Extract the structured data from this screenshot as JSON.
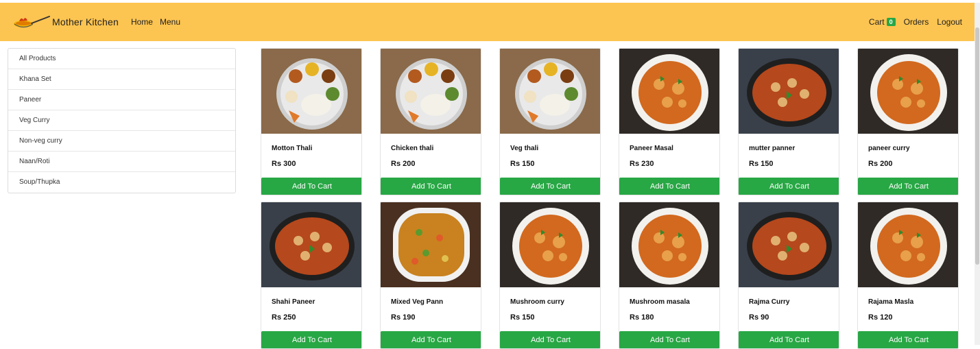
{
  "navbar": {
    "brand": "Mother Kitchen",
    "links": [
      "Home",
      "Menu"
    ],
    "cart_label": "Cart",
    "cart_count": "0",
    "orders_label": "Orders",
    "logout_label": "Logout"
  },
  "sidebar": {
    "categories": [
      "All Products",
      "Khana Set",
      "Paneer",
      "Veg Curry",
      "Non-veg curry",
      "Naan/Roti",
      "Soup/Thupka"
    ]
  },
  "products": [
    {
      "name": "Motton Thali",
      "price": "Rs 300",
      "button": "Add To Cart",
      "image": "thali-plate"
    },
    {
      "name": "Chicken thali",
      "price": "Rs 200",
      "button": "Add To Cart",
      "image": "thali-plate"
    },
    {
      "name": "Veg thali",
      "price": "Rs 150",
      "button": "Add To Cart",
      "image": "thali-plate"
    },
    {
      "name": "Paneer Masal",
      "price": "Rs 230",
      "button": "Add To Cart",
      "image": "curry-bowl"
    },
    {
      "name": "mutter panner",
      "price": "Rs 150",
      "button": "Add To Cart",
      "image": "curry-pan"
    },
    {
      "name": "paneer curry",
      "price": "Rs 200",
      "button": "Add To Cart",
      "image": "curry-bowl"
    },
    {
      "name": "Shahi Paneer",
      "price": "Rs 250",
      "button": "Add To Cart",
      "image": "curry-pan"
    },
    {
      "name": "Mixed Veg Pann",
      "price": "Rs 190",
      "button": "Add To Cart",
      "image": "curry-dish"
    },
    {
      "name": "Mushroom curry",
      "price": "Rs 150",
      "button": "Add To Cart",
      "image": "curry-bowl"
    },
    {
      "name": "Mushroom masala",
      "price": "Rs 180",
      "button": "Add To Cart",
      "image": "curry-bowl"
    },
    {
      "name": "Rajma Curry",
      "price": "Rs 90",
      "button": "Add To Cart",
      "image": "curry-pan"
    },
    {
      "name": "Rajama Masla",
      "price": "Rs 120",
      "button": "Add To Cart",
      "image": "curry-bowl"
    }
  ],
  "colors": {
    "navbar_bg": "#fcc451",
    "button_bg": "#28a745",
    "badge_bg": "#28a745"
  }
}
